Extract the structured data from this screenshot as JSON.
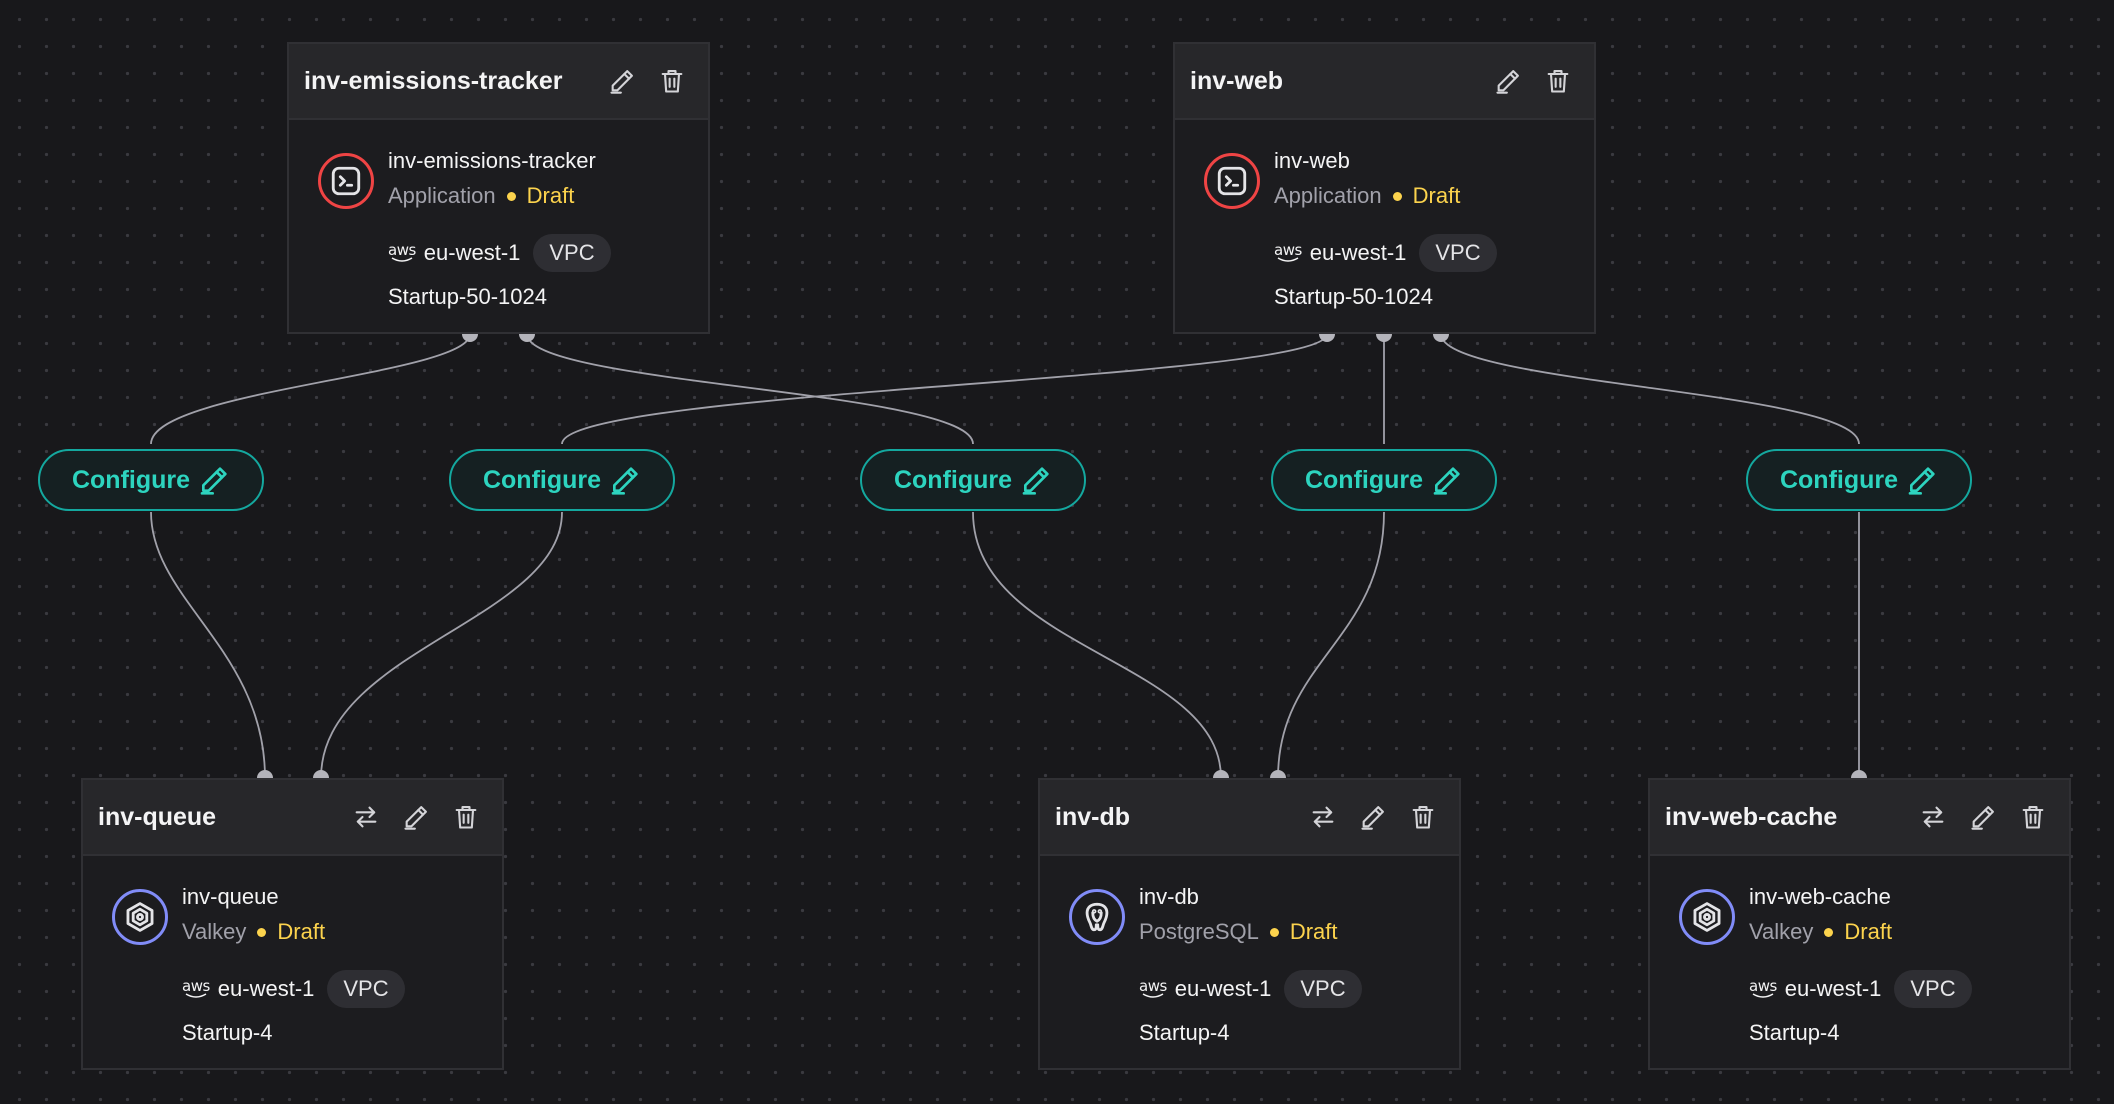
{
  "colors": {
    "canvas_bg": "#18181b",
    "accent_teal": "#2dd4bf",
    "draft_status": "#fcd34d",
    "application_ring": "#ef4444",
    "datastore_ring": "#818cf8"
  },
  "nodes": {
    "emissions": {
      "title": "inv-emissions-tracker",
      "name": "inv-emissions-tracker",
      "type": "Application",
      "status": "Draft",
      "provider": "aws",
      "region": "eu-west-1",
      "network": "VPC",
      "plan": "Startup-50-1024",
      "icon": "terminal-icon"
    },
    "web": {
      "title": "inv-web",
      "name": "inv-web",
      "type": "Application",
      "status": "Draft",
      "provider": "aws",
      "region": "eu-west-1",
      "network": "VPC",
      "plan": "Startup-50-1024",
      "icon": "terminal-icon"
    },
    "queue": {
      "title": "inv-queue",
      "name": "inv-queue",
      "type": "Valkey",
      "status": "Draft",
      "provider": "aws",
      "region": "eu-west-1",
      "network": "VPC",
      "plan": "Startup-4",
      "icon": "valkey-icon"
    },
    "db": {
      "title": "inv-db",
      "name": "inv-db",
      "type": "PostgreSQL",
      "status": "Draft",
      "provider": "aws",
      "region": "eu-west-1",
      "network": "VPC",
      "plan": "Startup-4",
      "icon": "postgresql-icon"
    },
    "cache": {
      "title": "inv-web-cache",
      "name": "inv-web-cache",
      "type": "Valkey",
      "status": "Draft",
      "provider": "aws",
      "region": "eu-west-1",
      "network": "VPC",
      "plan": "Startup-4",
      "icon": "valkey-icon"
    }
  },
  "connections": [
    {
      "from": "inv-emissions-tracker",
      "to": "inv-queue",
      "label": "Configure"
    },
    {
      "from": "inv-web",
      "to": "inv-queue",
      "label": "Configure"
    },
    {
      "from": "inv-emissions-tracker",
      "to": "inv-db",
      "label": "Configure"
    },
    {
      "from": "inv-web",
      "to": "inv-db",
      "label": "Configure"
    },
    {
      "from": "inv-web",
      "to": "inv-web-cache",
      "label": "Configure"
    }
  ]
}
